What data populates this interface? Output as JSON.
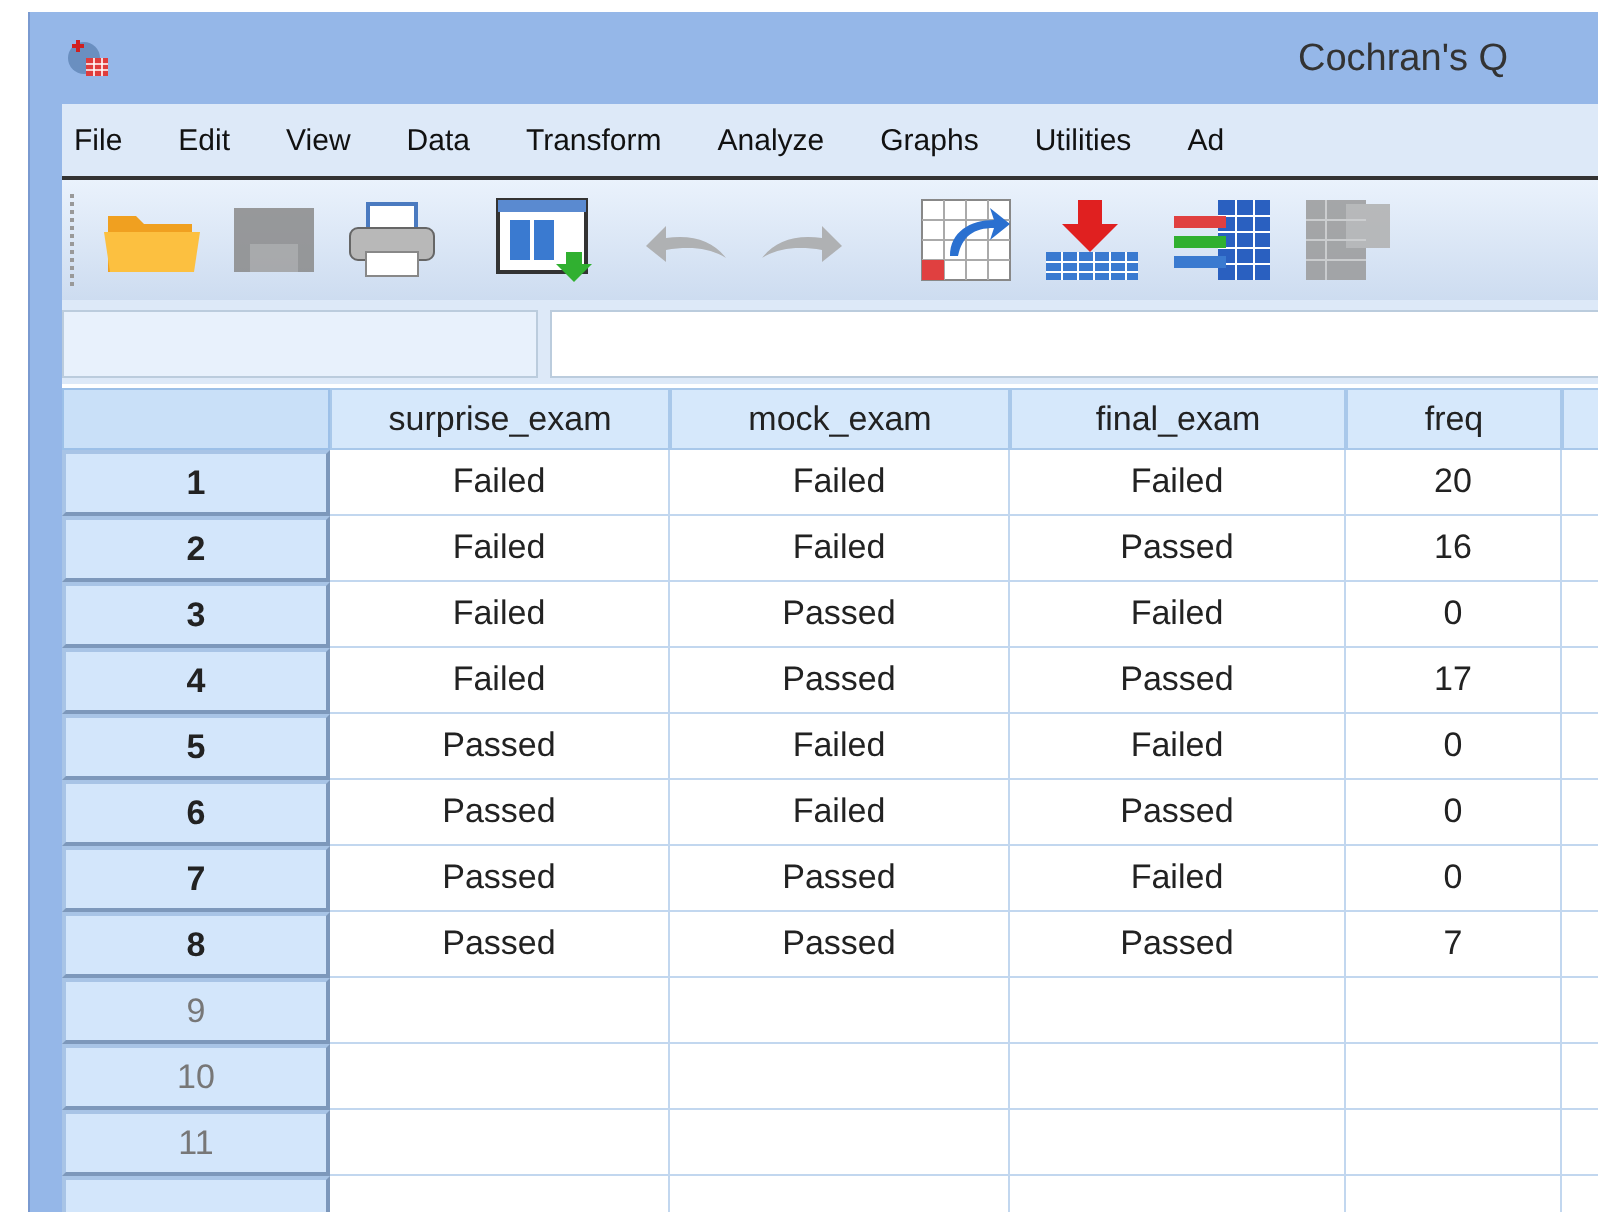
{
  "window": {
    "title": "Cochran's Q"
  },
  "menu": [
    "File",
    "Edit",
    "View",
    "Data",
    "Transform",
    "Analyze",
    "Graphs",
    "Utilities",
    "Ad"
  ],
  "toolbar": [
    {
      "kind": "open",
      "disabled": false
    },
    {
      "kind": "save",
      "disabled": true
    },
    {
      "kind": "print",
      "disabled": false
    },
    {
      "kind": "recall",
      "disabled": false
    },
    {
      "kind": "undo",
      "disabled": true
    },
    {
      "kind": "redo",
      "disabled": true
    },
    {
      "kind": "goto",
      "disabled": false
    },
    {
      "kind": "insert",
      "disabled": false
    },
    {
      "kind": "variables",
      "disabled": false
    },
    {
      "kind": "labels",
      "disabled": true
    }
  ],
  "table": {
    "columns": [
      "surprise_exam",
      "mock_exam",
      "final_exam",
      "freq"
    ],
    "rows": [
      {
        "number": "1",
        "cells": [
          "Failed",
          "Failed",
          "Failed",
          "20"
        ]
      },
      {
        "number": "2",
        "cells": [
          "Failed",
          "Failed",
          "Passed",
          "16"
        ]
      },
      {
        "number": "3",
        "cells": [
          "Failed",
          "Passed",
          "Failed",
          "0"
        ]
      },
      {
        "number": "4",
        "cells": [
          "Failed",
          "Passed",
          "Passed",
          "17"
        ]
      },
      {
        "number": "5",
        "cells": [
          "Passed",
          "Failed",
          "Failed",
          "0"
        ]
      },
      {
        "number": "6",
        "cells": [
          "Passed",
          "Failed",
          "Passed",
          "0"
        ]
      },
      {
        "number": "7",
        "cells": [
          "Passed",
          "Passed",
          "Failed",
          "0"
        ]
      },
      {
        "number": "8",
        "cells": [
          "Passed",
          "Passed",
          "Passed",
          "7"
        ]
      },
      {
        "number": "9"
      },
      {
        "number": "10"
      },
      {
        "number": "11"
      }
    ]
  }
}
